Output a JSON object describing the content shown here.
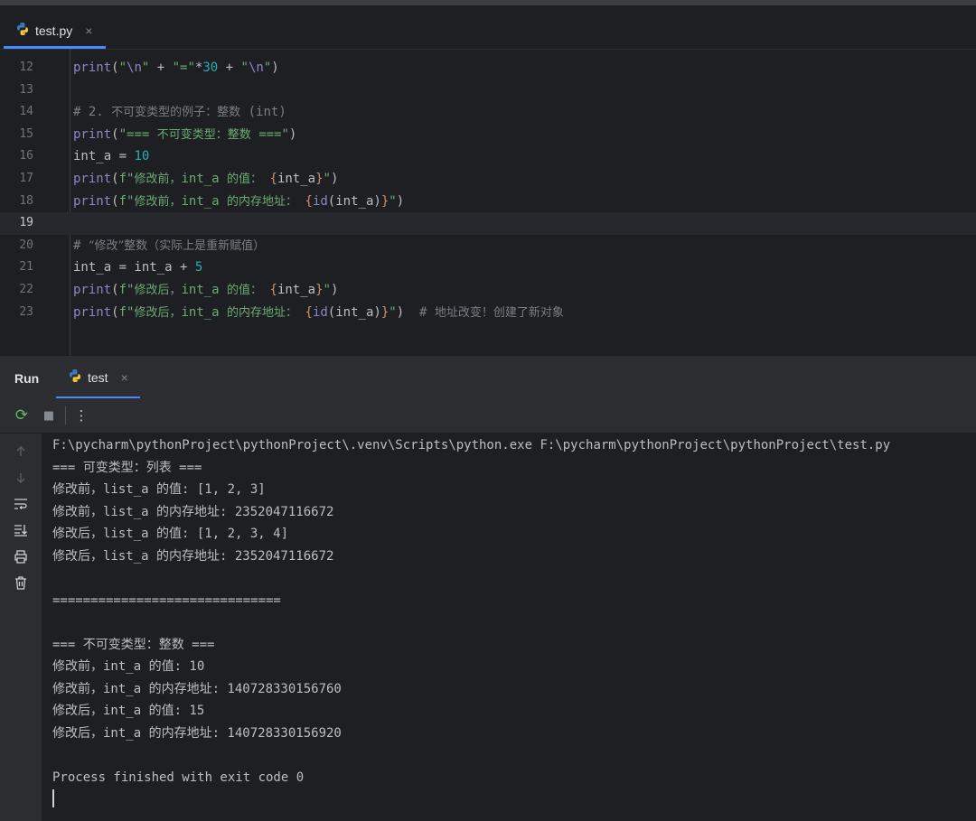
{
  "editor_tab": {
    "icon": "python-icon",
    "label": "test.py",
    "close": "×"
  },
  "code_lines": [
    {
      "n": "12",
      "tokens": [
        {
          "t": "kw",
          "v": "print"
        },
        {
          "t": "plain",
          "v": "("
        },
        {
          "t": "str",
          "v": "\""
        },
        {
          "t": "kw",
          "v": "\\n"
        },
        {
          "t": "str",
          "v": "\""
        },
        {
          "t": "plain",
          "v": " + "
        },
        {
          "t": "str",
          "v": "\"=\""
        },
        {
          "t": "plain",
          "v": "*"
        },
        {
          "t": "num",
          "v": "30"
        },
        {
          "t": "plain",
          "v": " + "
        },
        {
          "t": "str",
          "v": "\""
        },
        {
          "t": "kw",
          "v": "\\n"
        },
        {
          "t": "str",
          "v": "\""
        },
        {
          "t": "plain",
          "v": ")"
        }
      ]
    },
    {
      "n": "13",
      "tokens": []
    },
    {
      "n": "14",
      "tokens": [
        {
          "t": "cmt",
          "v": "# 2. "
        },
        {
          "t": "cmt cjk",
          "v": "不可变类型的例子：整数"
        },
        {
          "t": "cmt",
          "v": " (int)"
        }
      ]
    },
    {
      "n": "15",
      "tokens": [
        {
          "t": "kw",
          "v": "print"
        },
        {
          "t": "plain",
          "v": "("
        },
        {
          "t": "str",
          "v": "\"=== "
        },
        {
          "t": "str cjk",
          "v": "不可变类型：整数"
        },
        {
          "t": "str",
          "v": " ===\""
        },
        {
          "t": "plain",
          "v": ")"
        }
      ]
    },
    {
      "n": "16",
      "tokens": [
        {
          "t": "plain",
          "v": "int_a = "
        },
        {
          "t": "num",
          "v": "10"
        }
      ]
    },
    {
      "n": "17",
      "tokens": [
        {
          "t": "kw",
          "v": "print"
        },
        {
          "t": "plain",
          "v": "("
        },
        {
          "t": "str",
          "v": "f\""
        },
        {
          "t": "str cjk",
          "v": "修改前，"
        },
        {
          "t": "str",
          "v": "int_a "
        },
        {
          "t": "str cjk",
          "v": "的值："
        },
        {
          "t": "str",
          "v": " "
        },
        {
          "t": "brace",
          "v": "{"
        },
        {
          "t": "plain",
          "v": "int_a"
        },
        {
          "t": "brace",
          "v": "}"
        },
        {
          "t": "str",
          "v": "\""
        },
        {
          "t": "plain",
          "v": ")"
        }
      ]
    },
    {
      "n": "18",
      "tokens": [
        {
          "t": "kw",
          "v": "print"
        },
        {
          "t": "plain",
          "v": "("
        },
        {
          "t": "str",
          "v": "f\""
        },
        {
          "t": "str cjk",
          "v": "修改前，"
        },
        {
          "t": "str",
          "v": "int_a "
        },
        {
          "t": "str cjk",
          "v": "的内存地址："
        },
        {
          "t": "str",
          "v": " "
        },
        {
          "t": "brace",
          "v": "{"
        },
        {
          "t": "kw",
          "v": "id"
        },
        {
          "t": "plain",
          "v": "(int_a)"
        },
        {
          "t": "brace",
          "v": "}"
        },
        {
          "t": "str",
          "v": "\""
        },
        {
          "t": "plain",
          "v": ")"
        }
      ]
    },
    {
      "n": "19",
      "current": true,
      "tokens": []
    },
    {
      "n": "20",
      "tokens": [
        {
          "t": "cmt",
          "v": "# "
        },
        {
          "t": "cmt cjk",
          "v": "“修改”整数（实际上是重新赋值）"
        }
      ]
    },
    {
      "n": "21",
      "tokens": [
        {
          "t": "plain",
          "v": "int_a = int_a + "
        },
        {
          "t": "num",
          "v": "5"
        }
      ]
    },
    {
      "n": "22",
      "tokens": [
        {
          "t": "kw",
          "v": "print"
        },
        {
          "t": "plain",
          "v": "("
        },
        {
          "t": "str",
          "v": "f\""
        },
        {
          "t": "str cjk",
          "v": "修改后，"
        },
        {
          "t": "str",
          "v": "int_a "
        },
        {
          "t": "str cjk",
          "v": "的值："
        },
        {
          "t": "str",
          "v": " "
        },
        {
          "t": "brace",
          "v": "{"
        },
        {
          "t": "plain",
          "v": "int_a"
        },
        {
          "t": "brace",
          "v": "}"
        },
        {
          "t": "str",
          "v": "\""
        },
        {
          "t": "plain",
          "v": ")"
        }
      ]
    },
    {
      "n": "23",
      "tokens": [
        {
          "t": "kw",
          "v": "print"
        },
        {
          "t": "plain",
          "v": "("
        },
        {
          "t": "str",
          "v": "f\""
        },
        {
          "t": "str cjk",
          "v": "修改后，"
        },
        {
          "t": "str",
          "v": "int_a "
        },
        {
          "t": "str cjk",
          "v": "的内存地址："
        },
        {
          "t": "str",
          "v": " "
        },
        {
          "t": "brace",
          "v": "{"
        },
        {
          "t": "kw",
          "v": "id"
        },
        {
          "t": "plain",
          "v": "(int_a)"
        },
        {
          "t": "brace",
          "v": "}"
        },
        {
          "t": "str",
          "v": "\""
        },
        {
          "t": "plain",
          "v": ")  "
        },
        {
          "t": "cmt",
          "v": "# "
        },
        {
          "t": "cmt cjk",
          "v": "地址改变！创建了新对象"
        }
      ]
    }
  ],
  "run_panel": {
    "title": "Run",
    "tab_icon": "python-icon",
    "tab_label": "test",
    "tab_close": "×",
    "toolbar": {
      "rerun": "⟳",
      "stop": "■",
      "more": "⋮"
    },
    "side_icons": [
      "up-arrow-icon",
      "down-arrow-icon",
      "soft-wrap-icon",
      "scroll-to-end-icon",
      "print-icon",
      "trash-icon"
    ]
  },
  "console_lines": [
    "F:\\pycharm\\pythonProject\\pythonProject\\.venv\\Scripts\\python.exe F:\\pycharm\\pythonProject\\pythonProject\\test.py",
    "=== 可变类型：列表 ===",
    "修改前，list_a 的值: [1, 2, 3]",
    "修改前，list_a 的内存地址: 2352047116672",
    "修改后，list_a 的值: [1, 2, 3, 4]",
    "修改后，list_a 的内存地址: 2352047116672",
    "",
    "==============================",
    "",
    "=== 不可变类型：整数 ===",
    "修改前，int_a 的值: 10",
    "修改前，int_a 的内存地址: 140728330156760",
    "修改后，int_a 的值: 15",
    "修改后，int_a 的内存地址: 140728330156920",
    "",
    "Process finished with exit code 0"
  ],
  "colors": {
    "accent": "#4a88ff",
    "keyword": "#8888c6",
    "string": "#6aab73",
    "number": "#2aacb8",
    "comment": "#7a7e85",
    "brace": "#cf8e6d"
  }
}
